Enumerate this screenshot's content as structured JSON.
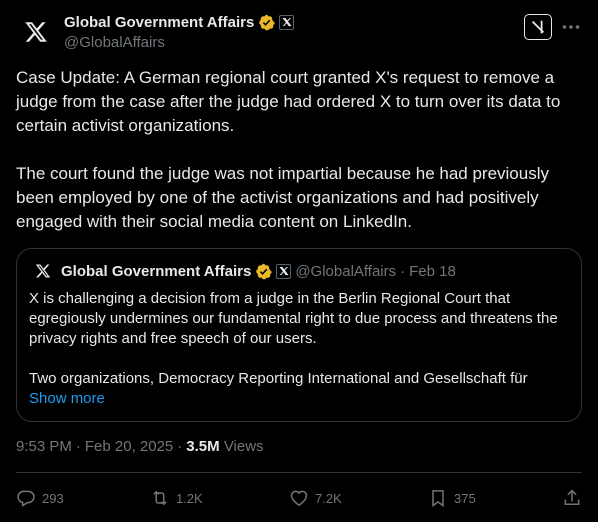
{
  "author": {
    "name": "Global Government Affairs",
    "handle": "@GlobalAffairs"
  },
  "tweet": {
    "text": "Case Update: A German regional court granted X's request to remove a judge from the case after the judge had ordered X to turn over its data to certain activist organizations.\n\nThe court found the judge was not impartial because he had previously been employed by one of the activist organizations and had positively engaged with their social media content on LinkedIn."
  },
  "quote": {
    "name": "Global Government Affairs",
    "handle": "@GlobalAffairs",
    "separator": "·",
    "date": "Feb 18",
    "text": "X is challenging a decision from a judge in the Berlin Regional Court that egregiously undermines our fundamental right to due process and threatens the privacy rights and free speech of our users.\n\nTwo organizations, Democracy Reporting International and Gesellschaft für",
    "show_more": "Show more"
  },
  "meta": {
    "time": "9:53 PM",
    "sep1": "·",
    "date": "Feb 20, 2025",
    "sep2": "·",
    "views": "3.5M",
    "views_label": "Views"
  },
  "actions": {
    "replies": "293",
    "reposts": "1.2K",
    "likes": "7.2K",
    "bookmarks": "375"
  },
  "icons": {
    "verified_color": "#e8b829",
    "link_color": "#1d9bf0",
    "muted_color": "#71767b",
    "header_icons": [
      "x-logo-icon",
      "verified-badge-icon",
      "affiliate-x-icon",
      "grok-icon",
      "more-icon"
    ],
    "action_icons": [
      "reply-icon",
      "repost-icon",
      "like-icon",
      "bookmark-icon",
      "share-icon"
    ]
  }
}
